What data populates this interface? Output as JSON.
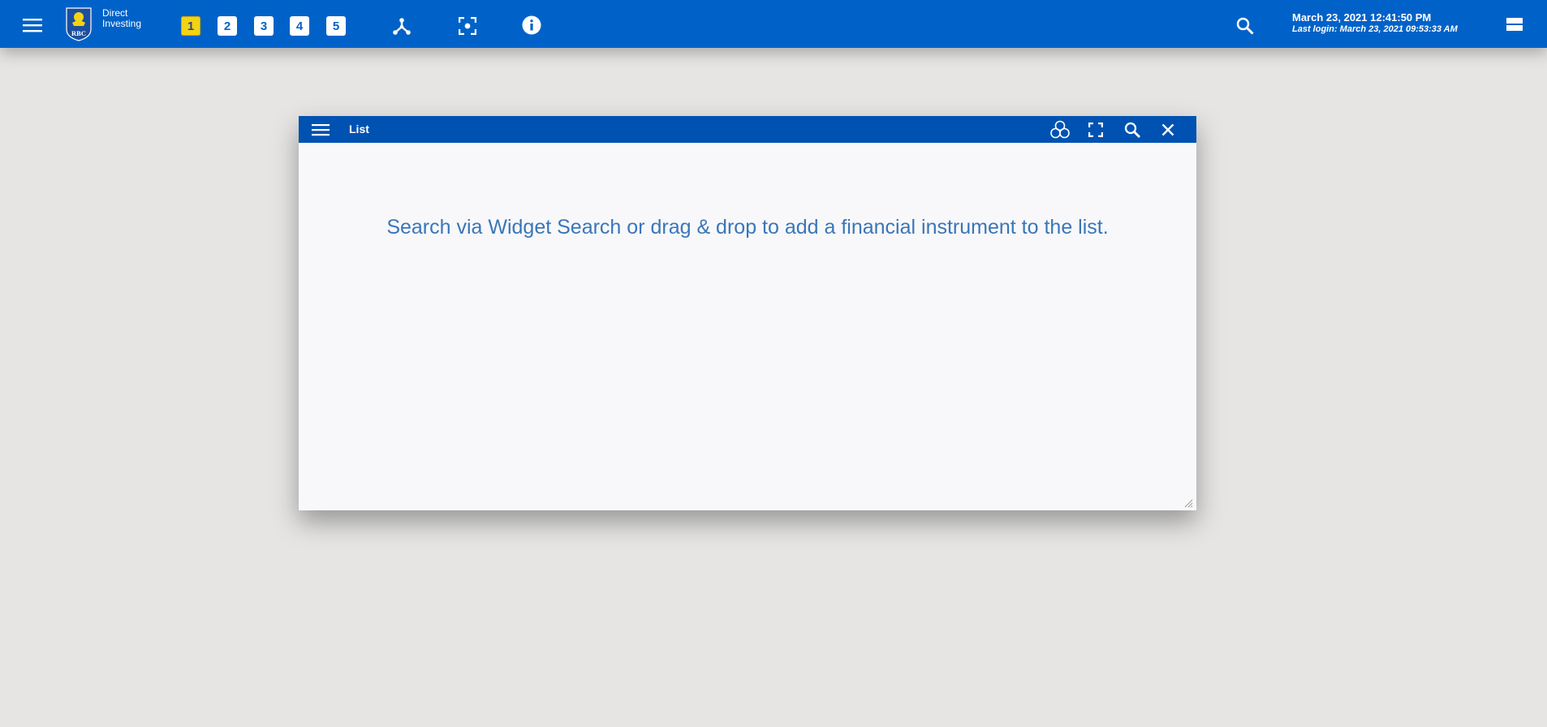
{
  "header": {
    "brand_line1": "Direct",
    "brand_line2": "Investing",
    "logo_text": "RBC",
    "workspaces": [
      "1",
      "2",
      "3",
      "4",
      "5"
    ],
    "active_workspace": "1",
    "datetime": "March 23, 2021 12:41:50 PM",
    "last_login": "Last login: March 23, 2021 09:53:33 AM",
    "icons": {
      "menu": "hamburger-menu-icon",
      "network": "network-link-icon",
      "focus": "focus-target-icon",
      "info": "info-icon",
      "search": "search-icon",
      "layout": "layout-toggle-icon"
    }
  },
  "widget": {
    "title": "List",
    "empty_message": "Search via Widget Search or drag & drop to add a financial instrument to the list.",
    "icons": {
      "menu": "hamburger-menu-icon",
      "link": "link-group-icon",
      "maximize": "maximize-icon",
      "search": "search-icon",
      "close": "close-icon",
      "resize": "resize-handle-icon"
    }
  },
  "colors": {
    "topbar": "#0062c8",
    "widget_header": "#0052b2",
    "background": "#e6e5e4",
    "active_workspace": "#f4d313",
    "message_text": "#3a76b8"
  }
}
